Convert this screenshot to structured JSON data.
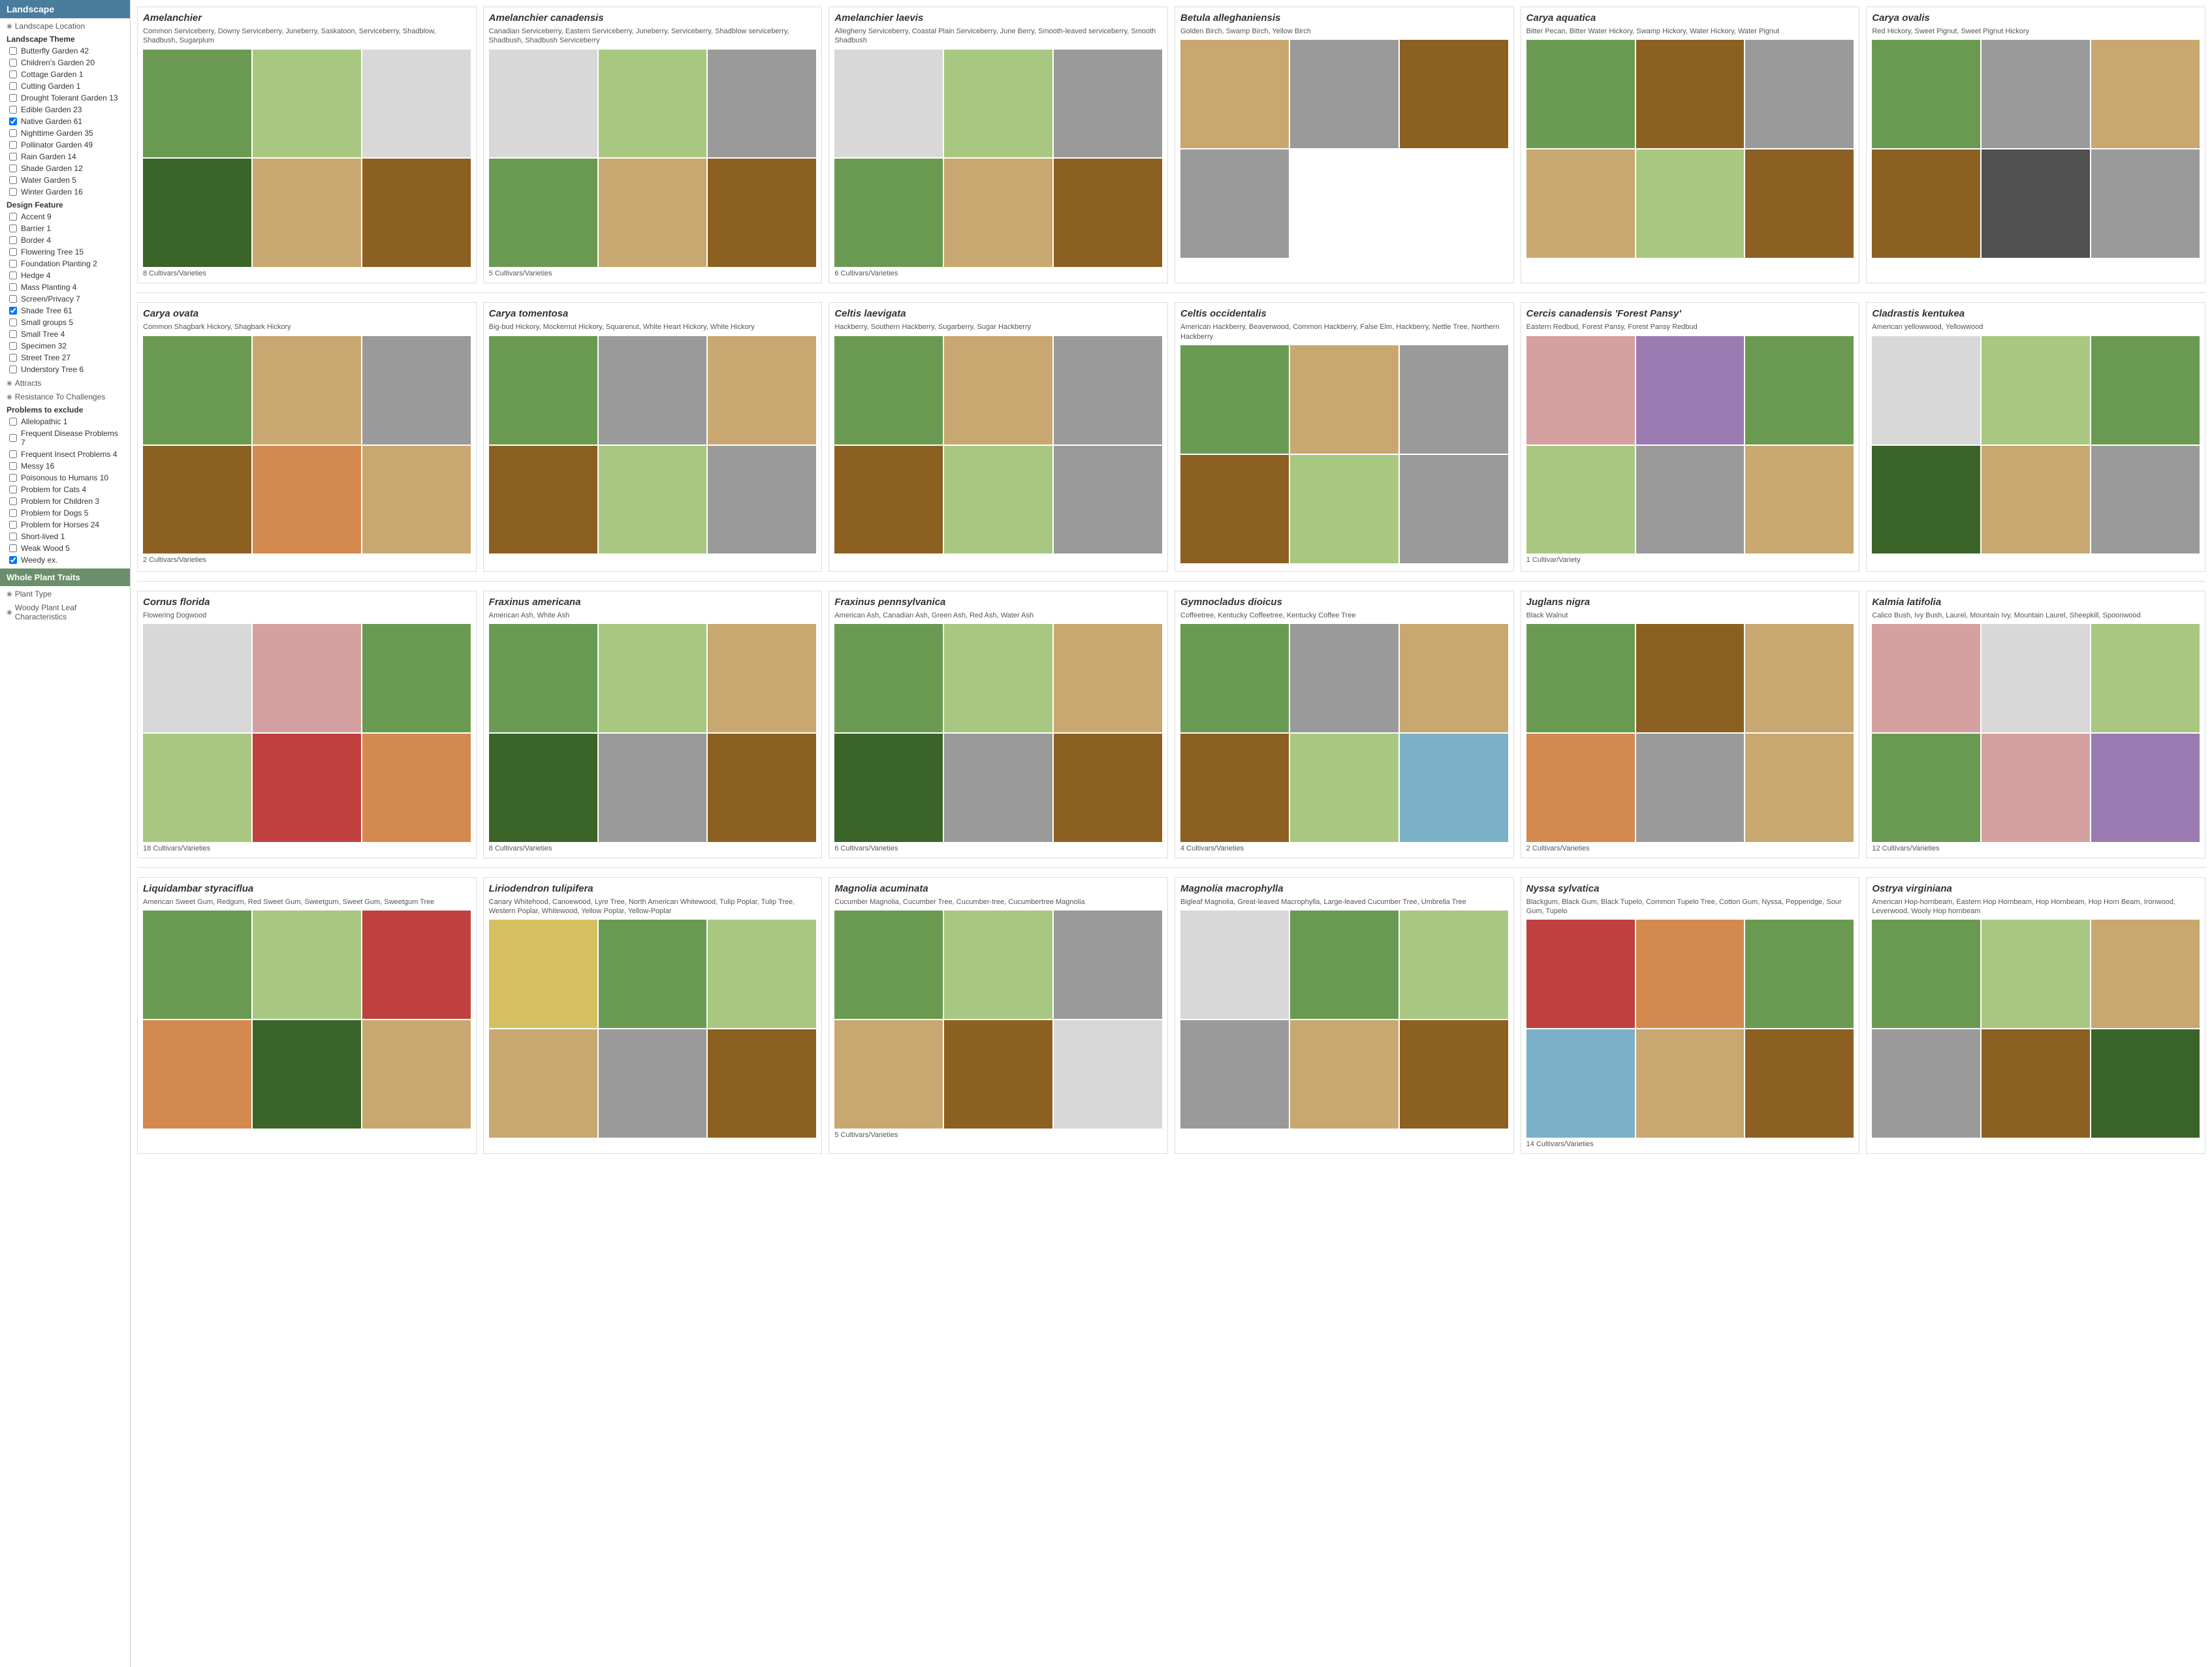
{
  "sidebar": {
    "header": "Landscape",
    "landscape_location_label": "Landscape Location",
    "landscape_theme_label": "Landscape Theme",
    "landscape_theme_items": [
      {
        "label": "Butterfly Garden 42",
        "checked": false
      },
      {
        "label": "Children's Garden 20",
        "checked": false
      },
      {
        "label": "Cottage Garden 1",
        "checked": false
      },
      {
        "label": "Cutting Garden 1",
        "checked": false
      },
      {
        "label": "Drought Tolerant Garden 13",
        "checked": false
      },
      {
        "label": "Edible Garden 23",
        "checked": false
      },
      {
        "label": "Native Garden 61",
        "checked": true
      },
      {
        "label": "Nighttime Garden 35",
        "checked": false
      },
      {
        "label": "Pollinator Garden 49",
        "checked": false
      },
      {
        "label": "Rain Garden 14",
        "checked": false
      },
      {
        "label": "Shade Garden 12",
        "checked": false
      },
      {
        "label": "Water Garden 5",
        "checked": false
      },
      {
        "label": "Winter Garden 16",
        "checked": false
      }
    ],
    "design_feature_label": "Design Feature",
    "design_feature_items": [
      {
        "label": "Accent 9",
        "checked": false
      },
      {
        "label": "Barrier 1",
        "checked": false
      },
      {
        "label": "Border 4",
        "checked": false
      },
      {
        "label": "Flowering Tree 15",
        "checked": false
      },
      {
        "label": "Foundation Planting 2",
        "checked": false
      },
      {
        "label": "Hedge 4",
        "checked": false
      },
      {
        "label": "Mass Planting 4",
        "checked": false
      },
      {
        "label": "Screen/Privacy 7",
        "checked": false
      },
      {
        "label": "Shade Tree 61",
        "checked": true
      },
      {
        "label": "Small groups 5",
        "checked": false
      },
      {
        "label": "Small Tree 4",
        "checked": false
      },
      {
        "label": "Specimen 32",
        "checked": false
      },
      {
        "label": "Street Tree 27",
        "checked": false
      },
      {
        "label": "Understory Tree 6",
        "checked": false
      }
    ],
    "attracts_label": "Attracts",
    "resistance_label": "Resistance To Challenges",
    "problems_label": "Problems to exclude",
    "problems_items": [
      {
        "label": "Allelopathic 1",
        "checked": false
      },
      {
        "label": "Frequent Disease Problems 7",
        "checked": false
      },
      {
        "label": "Frequent Insect Problems 4",
        "checked": false
      },
      {
        "label": "Messy 16",
        "checked": false
      },
      {
        "label": "Poisonous to Humans 10",
        "checked": false
      },
      {
        "label": "Problem for Cats 4",
        "checked": false
      },
      {
        "label": "Problem for Children 3",
        "checked": false
      },
      {
        "label": "Problem for Dogs 5",
        "checked": false
      },
      {
        "label": "Problem for Horses 24",
        "checked": false
      },
      {
        "label": "Short-lived 1",
        "checked": false
      },
      {
        "label": "Weak Wood 5",
        "checked": false
      },
      {
        "label": "Weedy ex.",
        "checked": true
      }
    ],
    "whole_plant_traits_label": "Whole Plant Traits",
    "plant_type_label": "Plant Type",
    "woody_leaf_label": "Woody Plant Leaf Characteristics"
  },
  "plants": [
    {
      "name": "Amelanchier",
      "common": "Common Serviceberry, Downy Serviceberry, Juneberry, Saskatoon, Serviceberry, Shadblow, Shadbush, Sugarplum",
      "cultivars": "8 Cultivars/Varieties",
      "images": [
        "green",
        "lightgreen",
        "white",
        "darkgreen",
        "tan",
        "brown",
        "gray",
        "gray"
      ]
    },
    {
      "name": "Amelanchier canadensis",
      "common": "Canadian Serviceberry, Eastern Serviceberry, Juneberry, Serviceberry, Shadblow serviceberry, Shadbush, Shadbush Serviceberry",
      "cultivars": "5 Cultivars/Varieties",
      "images": [
        "white",
        "lightgreen",
        "gray",
        "green",
        "tan",
        "brown",
        "lightgreen",
        "white",
        "gray",
        "gray",
        "tan",
        "brown"
      ]
    },
    {
      "name": "Amelanchier laevis",
      "common": "Allegheny Serviceberry, Coastal Plain Serviceberry, June Berry, Smooth-leaved serviceberry, Smooth Shadbush",
      "cultivars": "6 Cultivars/Varieties",
      "images": [
        "white",
        "lightgreen",
        "gray",
        "green",
        "tan",
        "brown"
      ]
    },
    {
      "name": "Betula alleghaniensis",
      "common": "Golden Birch, Swamp Birch, Yellow Birch",
      "cultivars": "",
      "images": [
        "tan",
        "gray",
        "brown",
        "gray"
      ]
    },
    {
      "name": "Carya aquatica",
      "common": "Bitter Pecan, Bitter Water Hickory, Swamp Hickory, Water Hickory, Water Pignut",
      "cultivars": "",
      "images": [
        "green",
        "brown",
        "gray",
        "tan",
        "lightgreen",
        "brown"
      ]
    },
    {
      "name": "Carya ovalis",
      "common": "Red Hickory, Sweet Pignut, Sweet Pignut Hickory",
      "cultivars": "",
      "images": [
        "green",
        "gray",
        "tan",
        "brown",
        "dark",
        "gray"
      ]
    },
    {
      "name": "Carya ovata",
      "common": "Common Shagbark Hickory, Shagbark Hickory",
      "cultivars": "2 Cultivars/Varieties",
      "images": [
        "green",
        "tan",
        "gray",
        "brown",
        "orange",
        "tan"
      ]
    },
    {
      "name": "Carya tomentosa",
      "common": "Big-bud Hickory, Mockernut Hickory, Squarenut, White Heart Hickory, White Hickory",
      "cultivars": "",
      "images": [
        "green",
        "gray",
        "tan",
        "brown",
        "lightgreen",
        "gray"
      ]
    },
    {
      "name": "Celtis laevigata",
      "common": "Hackberry, Southern Hackberry, Sugarberry, Sugar Hackberry",
      "cultivars": "",
      "images": [
        "green",
        "tan",
        "gray",
        "brown",
        "lightgreen",
        "gray"
      ]
    },
    {
      "name": "Celtis occidentalis",
      "common": "American Hackberry, Beaverwood, Common Hackberry, False Elm, Hackberry, Nettle Tree, Northern Hackberry",
      "cultivars": "",
      "images": [
        "green",
        "tan",
        "gray",
        "brown",
        "lightgreen",
        "gray",
        "darkgreen",
        "tan"
      ]
    },
    {
      "name": "Cercis canadensis 'Forest Pansy'",
      "common": "Eastern Redbud, Forest Pansy, Forest Pansy Redbud",
      "cultivars": "1 Cultivar/Variety",
      "images": [
        "pink",
        "purple",
        "green",
        "lightgreen",
        "gray",
        "tan"
      ]
    },
    {
      "name": "Cladrastis kentukea",
      "common": "American yellowwood, Yellowwood",
      "cultivars": "",
      "images": [
        "white",
        "lightgreen",
        "green",
        "darkgreen",
        "tan",
        "gray"
      ]
    },
    {
      "name": "Cornus florida",
      "common": "Flowering Dogwood",
      "cultivars": "18 Cultivars/Varieties",
      "images": [
        "white",
        "pink",
        "green",
        "lightgreen",
        "red",
        "orange",
        "brown",
        "gray",
        "tan",
        "gray"
      ]
    },
    {
      "name": "Fraxinus americana",
      "common": "American Ash, White Ash",
      "cultivars": "8 Cultivars/Varieties",
      "images": [
        "green",
        "lightgreen",
        "tan",
        "darkgreen",
        "gray",
        "brown"
      ]
    },
    {
      "name": "Fraxinus pennsylvanica",
      "common": "American Ash, Canadian Ash, Green Ash, Red Ash, Water Ash",
      "cultivars": "6 Cultivars/Varieties",
      "images": [
        "green",
        "lightgreen",
        "tan",
        "darkgreen",
        "gray",
        "brown"
      ]
    },
    {
      "name": "Gymnocladus dioicus",
      "common": "Coffeetree, Kentucky Coffeetree, Kentucky Coffee Tree",
      "cultivars": "4 Cultivars/Varieties",
      "images": [
        "green",
        "gray",
        "tan",
        "brown",
        "lightgreen",
        "blue",
        "darkgreen",
        "tan"
      ]
    },
    {
      "name": "Juglans nigra",
      "common": "Black Walnut",
      "cultivars": "2 Cultivars/Varieties",
      "images": [
        "green",
        "brown",
        "tan",
        "orange",
        "gray",
        "tan"
      ]
    },
    {
      "name": "Kalmia latifolia",
      "common": "Calico Bush, Ivy Bush, Laurel, Mountain Ivy, Mountain Laurel, Sheepkill, Spoonwood",
      "cultivars": "12 Cultivars/Varieties",
      "images": [
        "pink",
        "white",
        "lightgreen",
        "green",
        "pink",
        "purple",
        "white",
        "pink",
        "gray",
        "gray"
      ]
    },
    {
      "name": "Liquidambar styraciflua",
      "common": "American Sweet Gum, Redgum, Red Sweet Gum, Sweetgum, Sweet Gum, Sweetgum Tree",
      "cultivars": "",
      "images": [
        "green",
        "lightgreen",
        "red",
        "orange",
        "darkgreen",
        "tan"
      ]
    },
    {
      "name": "Liriodendron tulipifera",
      "common": "Canary Whitehood, Canoewood, Lyre Tree, North American Whitewood, Tulip Poplar, Tulip Tree, Western Poplar, Whitewood, Yellow Poplar, Yellow-Poplar",
      "cultivars": "",
      "images": [
        "yellow",
        "green",
        "lightgreen",
        "tan",
        "gray",
        "brown",
        "white",
        "green",
        "gray",
        "tan"
      ]
    },
    {
      "name": "Magnolia acuminata",
      "common": "Cucumber Magnolia, Cucumber Tree, Cucumber-tree, Cucumbertree Magnolia",
      "cultivars": "5 Cultivars/Varieties",
      "images": [
        "green",
        "lightgreen",
        "gray",
        "tan",
        "brown",
        "white"
      ]
    },
    {
      "name": "Magnolia macrophylla",
      "common": "Bigleaf Magnolia, Great-leaved Macrophylla, Large-leaved Cucumber Tree, Umbrella Tree",
      "cultivars": "",
      "images": [
        "white",
        "green",
        "lightgreen",
        "gray",
        "tan",
        "brown"
      ]
    },
    {
      "name": "Nyssa sylvatica",
      "common": "Blackgum, Black Gum, Black Tupelo, Common Tupelo Tree, Cotton Gum, Nyssa, Pepperidge, Sour Gum, Tupelo",
      "cultivars": "14 Cultivars/Varieties",
      "images": [
        "red",
        "orange",
        "green",
        "blue",
        "tan",
        "brown"
      ]
    },
    {
      "name": "Ostrya virginiana",
      "common": "American Hop-hornbeam, Eastern Hop Hornbeam, Hop Hornbeam, Hop Horn Beam, Ironwood, Leverwood, Wooly Hop hornbeam",
      "cultivars": "",
      "images": [
        "green",
        "lightgreen",
        "tan",
        "gray",
        "brown",
        "darkgreen"
      ]
    }
  ]
}
